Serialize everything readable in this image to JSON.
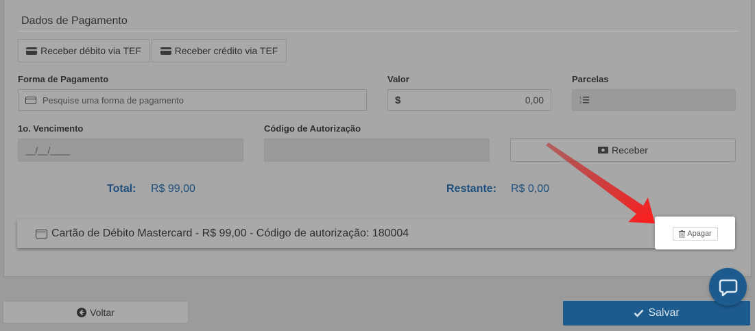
{
  "section": {
    "title": "Dados de Pagamento"
  },
  "tef_buttons": {
    "debit_label": "Receber débito via TEF",
    "credit_label": "Receber crédito via TEF"
  },
  "form": {
    "forma_pagamento": {
      "label": "Forma de Pagamento",
      "placeholder": "Pesquise uma forma de pagamento",
      "value": ""
    },
    "valor": {
      "label": "Valor",
      "currency_symbol": "$",
      "value": "0,00"
    },
    "parcelas": {
      "label": "Parcelas",
      "value": ""
    },
    "vencimento": {
      "label": "1o. Vencimento",
      "placeholder": "__/__/____",
      "value": ""
    },
    "codigo_autorizacao": {
      "label": "Código de Autorização",
      "value": ""
    },
    "receber_label": "Receber"
  },
  "totals": {
    "total_label": "Total:",
    "total_value": "R$ 99,00",
    "restante_label": "Restante:",
    "restante_value": "R$ 0,00"
  },
  "payments": [
    {
      "description": "Cartão de Débito Mastercard - R$ 99,00 - Código de autorização: 180004",
      "delete_label": "Apagar"
    }
  ],
  "footer": {
    "back_label": "Voltar",
    "save_label": "Salvar"
  },
  "colors": {
    "primary": "#1d5b8f",
    "arrow": "#e31b1b",
    "overlay_bg": "#9b9b9b"
  },
  "icons": {
    "card": "credit-card-icon",
    "list": "list-ordered-icon",
    "money": "money-icon",
    "trash": "trash-icon",
    "back": "arrow-circle-left-icon",
    "check": "check-icon",
    "chat": "chat-icon"
  }
}
